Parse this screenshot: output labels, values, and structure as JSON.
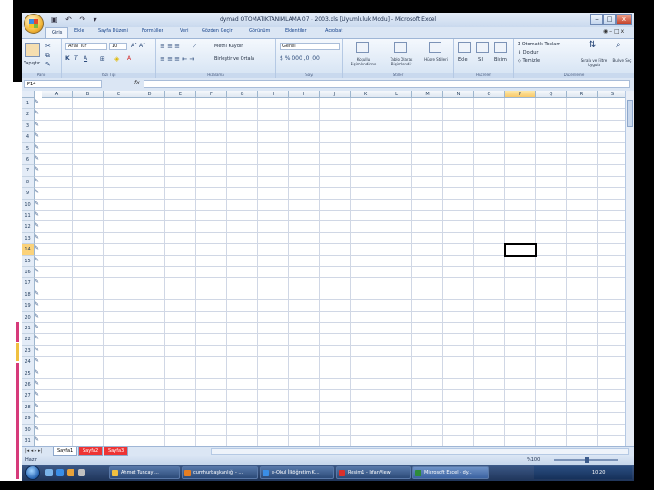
{
  "window": {
    "title": "dymad OTOMATIKTANIMLAMA 07 - 2003.xls [Uyumluluk Modu] - Microsoft Excel",
    "quick_access": "▣ ↶ ↷ ▾"
  },
  "ribbon": {
    "tabs": [
      "Giriş",
      "Ekle",
      "Sayfa Düzeni",
      "Formüller",
      "Veri",
      "Gözden Geçir",
      "Görünüm",
      "Eklentiler",
      "Acrobat"
    ],
    "active_tab": "Giriş",
    "clipboard": {
      "paste": "Yapıştır",
      "label": "Pano"
    },
    "font": {
      "name": "Arial Tur",
      "size": "10",
      "label": "Yazı Tipi"
    },
    "alignment": {
      "wrap": "Metni Kaydır",
      "merge": "Birleştir ve Ortala",
      "label": "Hizalama"
    },
    "number": {
      "format": "Genel",
      "label": "Sayı"
    },
    "styles": {
      "conditional": "Koşullu Biçimlendirme",
      "table": "Tablo Olarak Biçimlendir",
      "cell": "Hücre Stilleri",
      "label": "Stiller"
    },
    "cells": {
      "insert": "Ekle",
      "delete": "Sil",
      "format": "Biçim",
      "label": "Hücreler"
    },
    "editing": {
      "autosum": "Otomatik Toplam",
      "fill": "Doldur",
      "clear": "Temizle",
      "sort": "Sırala ve Filtre Uygula",
      "find": "Bul ve Seç",
      "label": "Düzenleme"
    }
  },
  "formula_bar": {
    "name_box": "P14",
    "fx": "fx",
    "value": ""
  },
  "columns": [
    "A",
    "B",
    "C",
    "D",
    "E",
    "F",
    "G",
    "H",
    "I",
    "J",
    "K",
    "L",
    "M",
    "N",
    "O",
    "P",
    "Q",
    "R",
    "S"
  ],
  "selected_column": "P",
  "rows": [
    "1",
    "2",
    "3",
    "4",
    "5",
    "6",
    "7",
    "8",
    "9",
    "10",
    "11",
    "12",
    "13",
    "14",
    "15",
    "16",
    "17",
    "18",
    "19",
    "20",
    "21",
    "22",
    "23",
    "24",
    "25",
    "26",
    "27",
    "28",
    "29",
    "30",
    "31"
  ],
  "selected_row": "14",
  "sheets": [
    "Sayfa1",
    "Sayfa2",
    "Sayfa3"
  ],
  "status": {
    "left": "Hazır",
    "zoom": "%100"
  },
  "taskbar": {
    "items": [
      {
        "label": "Ahmet Tuncay ...",
        "color": "#f0c040"
      },
      {
        "label": "cumhurbaşkanlığı - ...",
        "color": "#e67e22"
      },
      {
        "label": "e-Okul İlköğretim K...",
        "color": "#3a8ee6"
      },
      {
        "label": "Resim1 - IrfanView",
        "color": "#d9302c"
      },
      {
        "label": "Microsoft Excel - dy...",
        "color": "#2e8b3a"
      }
    ],
    "clock": "10:20"
  },
  "colors": {
    "selected_header": "#f9c96a",
    "grid_line": "#d0d7e5"
  }
}
